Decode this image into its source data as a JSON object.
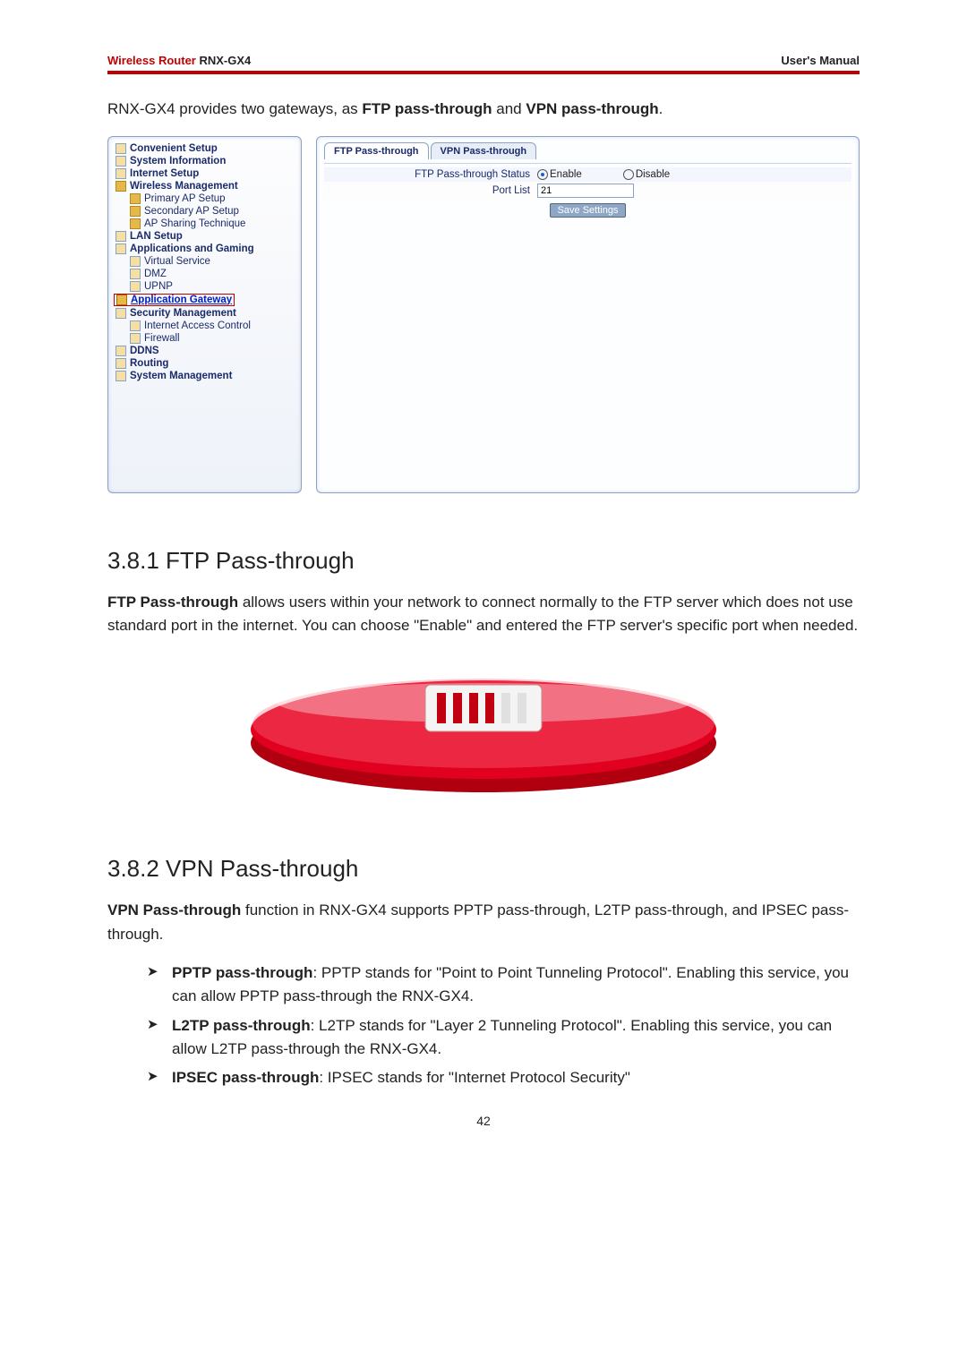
{
  "header": {
    "brand": "Wireless Router",
    "model": "RNX-GX4",
    "right": "User's Manual"
  },
  "intro": {
    "prefix": "RNX-GX4 provides two gateways, as ",
    "b1": "FTP pass-through",
    "mid": " and ",
    "b2": "VPN pass-through",
    "suffix": "."
  },
  "nav": {
    "convenient": "Convenient Setup",
    "sysinfo": "System Information",
    "inet": "Internet Setup",
    "wmgmt": "Wireless Management",
    "pap": "Primary AP Setup",
    "sap": "Secondary AP Setup",
    "apshare": "AP Sharing Technique",
    "lan": "LAN Setup",
    "apps": "Applications and Gaming",
    "vservice": "Virtual Service",
    "dmz": "DMZ",
    "upnp": "UPNP",
    "appgw": "Application Gateway",
    "secmgmt": "Security Management",
    "iac": "Internet Access Control",
    "fw": "Firewall",
    "ddns": "DDNS",
    "routing": "Routing",
    "sysmgmt": "System Management"
  },
  "tabs": {
    "ftp": "FTP Pass-through",
    "vpn": "VPN Pass-through"
  },
  "form": {
    "status_label": "FTP Pass-through Status",
    "enable": "Enable",
    "disable": "Disable",
    "port_label": "Port List",
    "port_value": "21",
    "save": "Save Settings"
  },
  "s381": {
    "heading": "3.8.1 FTP Pass-through",
    "b": "FTP Pass-through",
    "text": " allows users within your network to connect normally to the FTP server which does not use standard port in the internet. You can choose \"Enable\" and entered the FTP server's specific port when needed."
  },
  "s382": {
    "heading": "3.8.2 VPN Pass-through",
    "b": "VPN Pass-through",
    "text": " function in RNX-GX4 supports PPTP pass-through, L2TP pass-through, and IPSEC pass-through.",
    "bul1_b": "PPTP pass-through",
    "bul1_t": ": PPTP stands for \"Point to Point Tunneling Protocol\". Enabling this service, you can allow PPTP pass-through the RNX-GX4.",
    "bul2_b": "L2TP pass-through",
    "bul2_t": ": L2TP stands for \"Layer 2 Tunneling Protocol\". Enabling this service, you can allow L2TP pass-through the RNX-GX4.",
    "bul3_b": "IPSEC pass-through",
    "bul3_t": ": IPSEC stands for \"Internet Protocol Security\""
  },
  "pagenum": "42"
}
